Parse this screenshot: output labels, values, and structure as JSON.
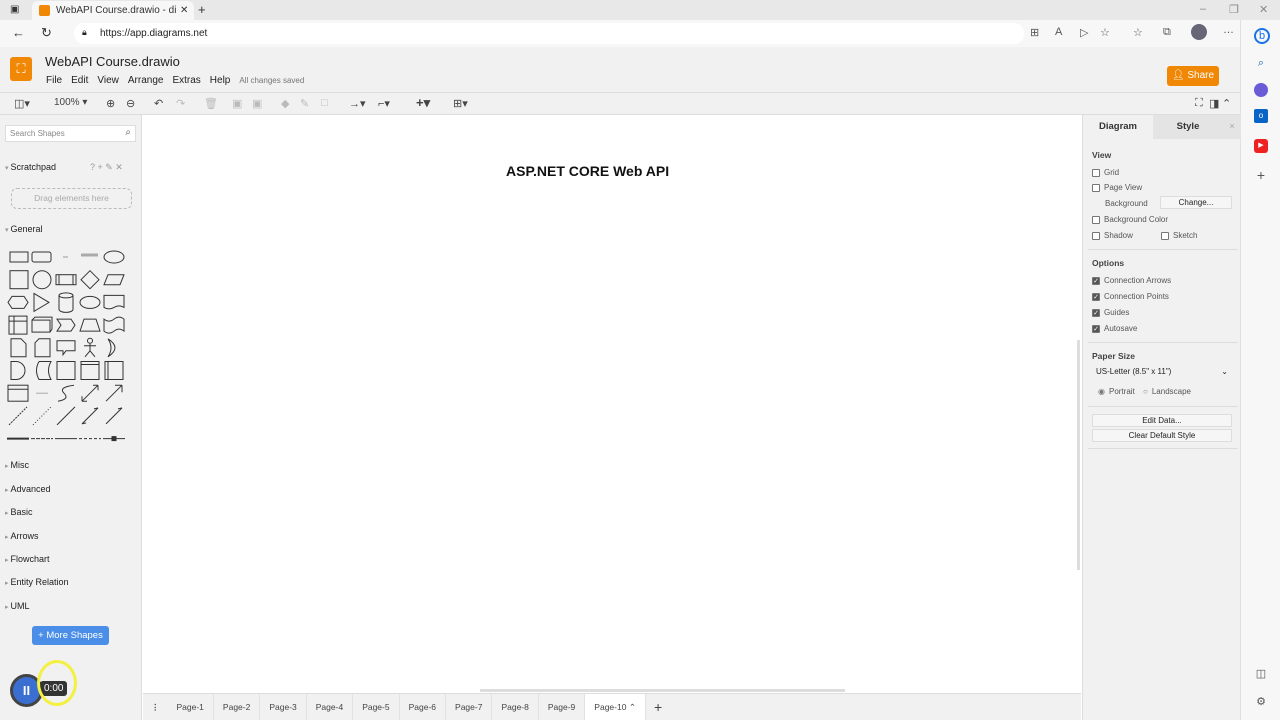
{
  "browser": {
    "tab_title": "WebAPI Course.drawio - diagrams",
    "url": "https://app.diagrams.net"
  },
  "app": {
    "title": "WebAPI Course.drawio",
    "menu": [
      "File",
      "Edit",
      "View",
      "Arrange",
      "Extras",
      "Help"
    ],
    "status": "All changes saved",
    "share_label": "Share",
    "zoom": "100%"
  },
  "sidebar": {
    "search_placeholder": "Search Shapes",
    "scratchpad": "Scratchpad",
    "drag_hint": "Drag elements here",
    "general": "General",
    "sections": [
      "Misc",
      "Advanced",
      "Basic",
      "Arrows",
      "Flowchart",
      "Entity Relation",
      "UML"
    ],
    "more_shapes": "+ More Shapes"
  },
  "canvas": {
    "heading": "ASP.NET CORE Web API"
  },
  "pages": [
    "Page-1",
    "Page-2",
    "Page-3",
    "Page-4",
    "Page-5",
    "Page-6",
    "Page-7",
    "Page-8",
    "Page-9",
    "Page-10"
  ],
  "panel": {
    "tabs": [
      "Diagram",
      "Style"
    ],
    "view": "View",
    "grid": "Grid",
    "page_view": "Page View",
    "background": "Background",
    "change": "Change...",
    "background_color": "Background Color",
    "shadow": "Shadow",
    "sketch": "Sketch",
    "options": "Options",
    "connection_arrows": "Connection Arrows",
    "connection_points": "Connection Points",
    "guides": "Guides",
    "autosave": "Autosave",
    "paper_size": "Paper Size",
    "paper_value": "US-Letter (8.5\" x 11\")",
    "portrait": "Portrait",
    "landscape": "Landscape",
    "edit_data": "Edit Data...",
    "clear_style": "Clear Default Style"
  },
  "recorder": {
    "time": "0:00"
  },
  "colors": {
    "accent": "#f08705",
    "button_blue": "#4a8ee8"
  }
}
